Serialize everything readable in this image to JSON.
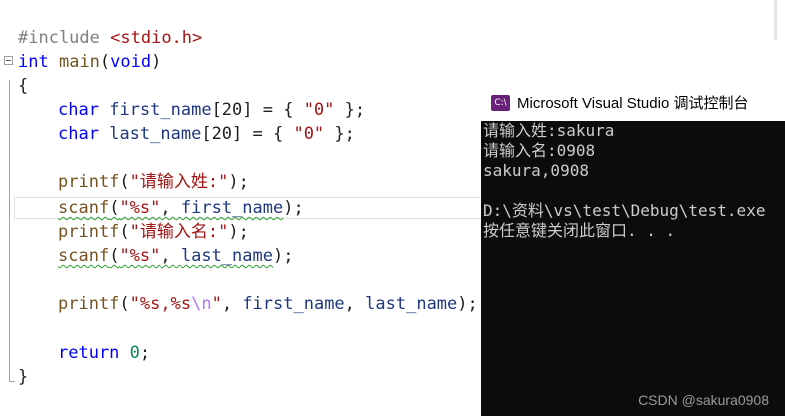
{
  "editor": {
    "include": {
      "directive": "#include",
      "header": "<stdio.h>"
    },
    "main_sig": {
      "type": "int",
      "name": "main",
      "open": "(",
      "param": "void",
      "close": ")"
    },
    "brace_open": "{",
    "line_fname": {
      "type": "char",
      "var": "first_name",
      "rest": "[20] = { ",
      "str": "\"0\"",
      "end": " };"
    },
    "line_lname": {
      "type": "char",
      "var": "last_name",
      "rest": "[20] = { ",
      "str": "\"0\"",
      "end": " };"
    },
    "line_printf1": {
      "fn": "printf",
      "open": "(",
      "str": "\"请输入姓:\"",
      "end": ");"
    },
    "line_scanf1": {
      "fn": "scanf",
      "open": "(",
      "str": "\"%s\"",
      "sep": ", ",
      "var": "first_name",
      "end": ");"
    },
    "line_printf2": {
      "fn": "printf",
      "open": "(",
      "str": "\"请输入名:\"",
      "end": ");"
    },
    "line_scanf2": {
      "fn": "scanf",
      "open": "(",
      "str": "\"%s\"",
      "sep": ", ",
      "var": "last_name",
      "end": ");"
    },
    "line_printf3": {
      "fn": "printf",
      "open": "(",
      "str_a": "\"%s,%s",
      "esc": "\\n",
      "str_b": "\"",
      "sep1": ", ",
      "var1": "first_name",
      "sep2": ", ",
      "var2": "last_name",
      "end": ");"
    },
    "line_return": {
      "kw": "return",
      "num": "0",
      "end": ";"
    },
    "brace_close": "}"
  },
  "console": {
    "icon_label": "C:\\",
    "title": "Microsoft Visual Studio 调试控制台",
    "lines": [
      "请输入姓:sakura",
      "请输入名:0908",
      "sakura,0908",
      "",
      "D:\\资料\\vs\\test\\Debug\\test.exe",
      "按任意键关闭此窗口. . ."
    ]
  },
  "watermark": "CSDN @sakura0908"
}
